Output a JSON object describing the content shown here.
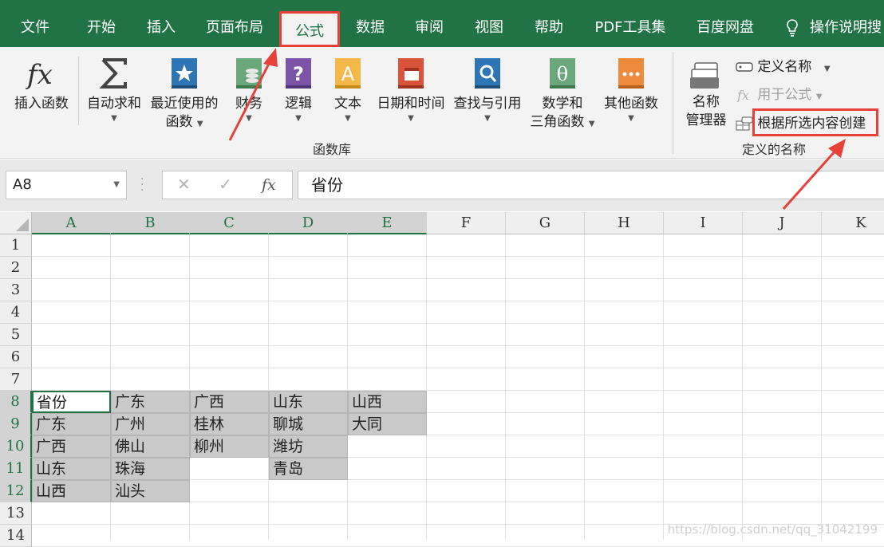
{
  "tabs": [
    "文件",
    "开始",
    "插入",
    "页面布局",
    "公式",
    "数据",
    "审阅",
    "视图",
    "帮助",
    "PDF工具集",
    "百度网盘"
  ],
  "active_tab": "公式",
  "tell_me": "操作说明搜",
  "ribbon": {
    "insert_function": "插入函数",
    "autosum": "自动求和",
    "recent_line1": "最近使用的",
    "recent_line2": "函数",
    "financial": "财务",
    "logical": "逻辑",
    "text": "文本",
    "datetime": "日期和时间",
    "lookup": "查找与引用",
    "math_line1": "数学和",
    "math_line2": "三角函数",
    "more": "其他函数",
    "library_group": "函数库",
    "name_manager_line1": "名称",
    "name_manager_line2": "管理器",
    "define_name": "定义名称",
    "use_in_formula": "用于公式",
    "create_from_selection": "根据所选内容创建",
    "defined_names_group": "定义的名称"
  },
  "formula_bar": {
    "name_box": "A8",
    "fx": "fx",
    "content": "省份"
  },
  "columns": [
    "A",
    "B",
    "C",
    "D",
    "E",
    "F",
    "G",
    "H",
    "I",
    "J",
    "K"
  ],
  "rows": [
    "1",
    "2",
    "3",
    "4",
    "5",
    "6",
    "7",
    "8",
    "9",
    "10",
    "11",
    "12",
    "13",
    "14"
  ],
  "cells": {
    "A8": "省份",
    "B8": "广东",
    "C8": "广西",
    "D8": "山东",
    "E8": "山西",
    "A9": "广东",
    "B9": "广州",
    "C9": "桂林",
    "D9": "聊城",
    "E9": "大同",
    "A10": "广西",
    "B10": "佛山",
    "C10": "柳州",
    "D10": "潍坊",
    "A11": "山东",
    "B11": "珠海",
    "D11": "青岛",
    "A12": "山西",
    "B12": "汕头"
  },
  "watermark": "https://blog.csdn.net/qq_31042199",
  "colors": {
    "accent": "#217346",
    "highlight": "#e8413a",
    "selection": "#c9c9c9"
  }
}
